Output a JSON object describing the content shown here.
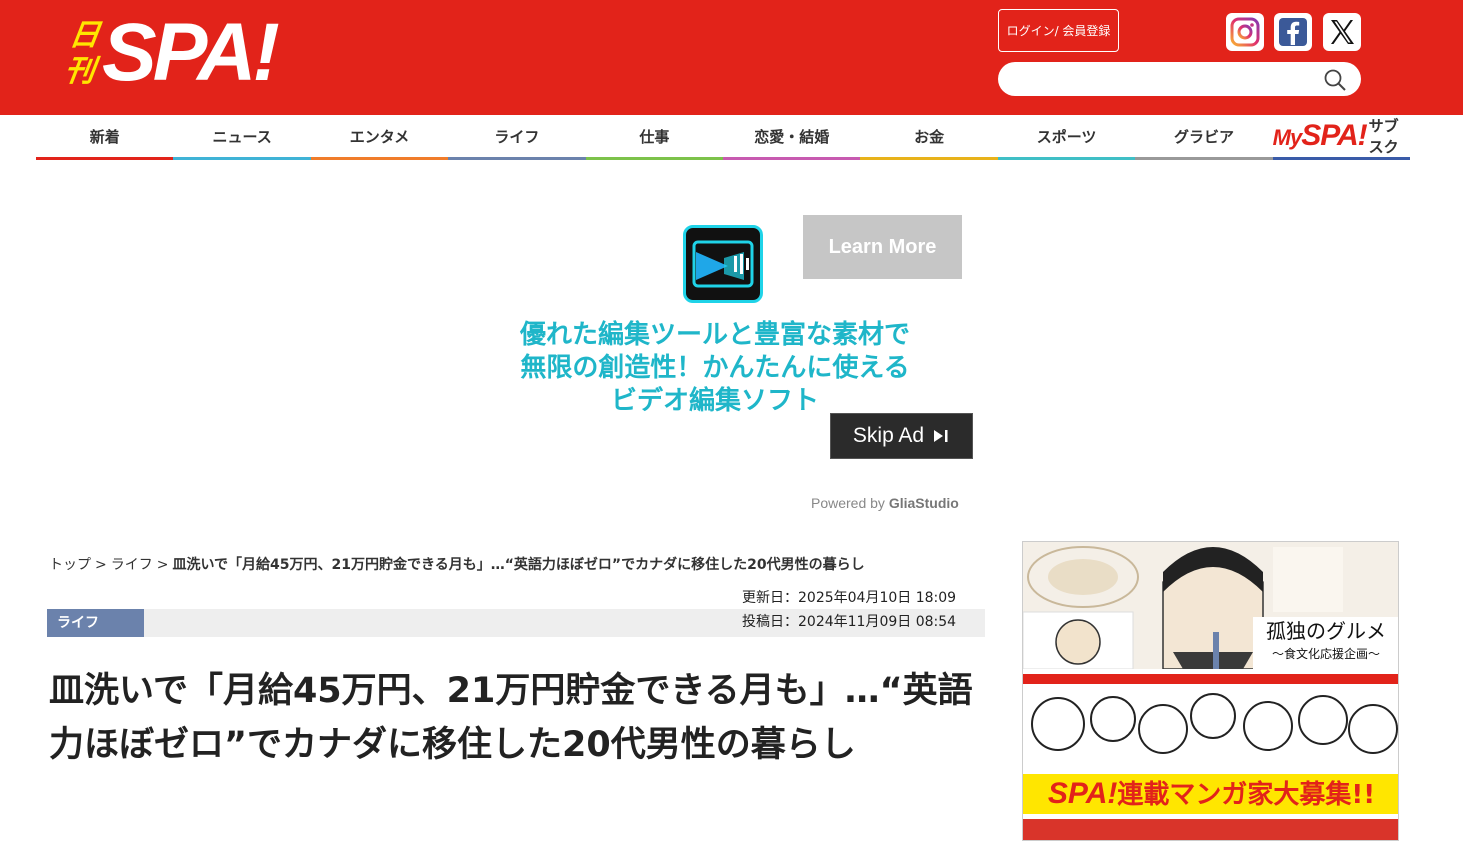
{
  "header": {
    "logo_nikkan": "日刊",
    "logo_spa": "SPA!",
    "login_label": "ログイン/ 会員登録",
    "search_placeholder": ""
  },
  "social": [
    "instagram-icon",
    "facebook-icon",
    "x-icon"
  ],
  "nav": {
    "items": [
      {
        "label": "新着",
        "color": "#e2231a"
      },
      {
        "label": "ニュース",
        "color": "#3fb3d6"
      },
      {
        "label": "エンタメ",
        "color": "#f07c2a"
      },
      {
        "label": "ライフ",
        "color": "#6b82ac"
      },
      {
        "label": "仕事",
        "color": "#7cc24a"
      },
      {
        "label": "恋愛・結婚",
        "color": "#c75ab0"
      },
      {
        "label": "お金",
        "color": "#e8b21a"
      },
      {
        "label": "スポーツ",
        "color": "#3fbfc6"
      },
      {
        "label": "グラビア",
        "color": "#999999"
      }
    ],
    "subscribe": {
      "logo": "My",
      "logo_spa": "SPA!",
      "label": "サブスク",
      "color": "#3a5ba8"
    }
  },
  "ad": {
    "learn_more": "Learn More",
    "text": "優れた編集ツールと豊富な素材で無限の創造性！かんたんに使えるビデオ編集ソフト",
    "skip": "Skip Ad",
    "powered_by": "Powered by",
    "powered_brand": "GliaStudio"
  },
  "breadcrumb": {
    "top": "トップ",
    "category": "ライフ",
    "current": "皿洗いで「月給45万円、21万円貯金できる月も」…“英語力ほぼゼロ”でカナダに移住した20代男性の暮らし"
  },
  "article": {
    "category_tag": "ライフ",
    "updated": "更新日：2025年04月10日 18:09",
    "posted": "投稿日：2024年11月09日 08:54",
    "title": "皿洗いで「月給45万円、21万円貯金できる月も」…“英語力ほぼゼロ”でカナダに移住した20代男性の暮らし"
  },
  "side": {
    "gourmet_title": "孤独のグルメ",
    "gourmet_sub": "〜食文化応援企画〜",
    "manga_spa": "SPA!",
    "manga_text": "連載マンガ家大募集!!"
  }
}
